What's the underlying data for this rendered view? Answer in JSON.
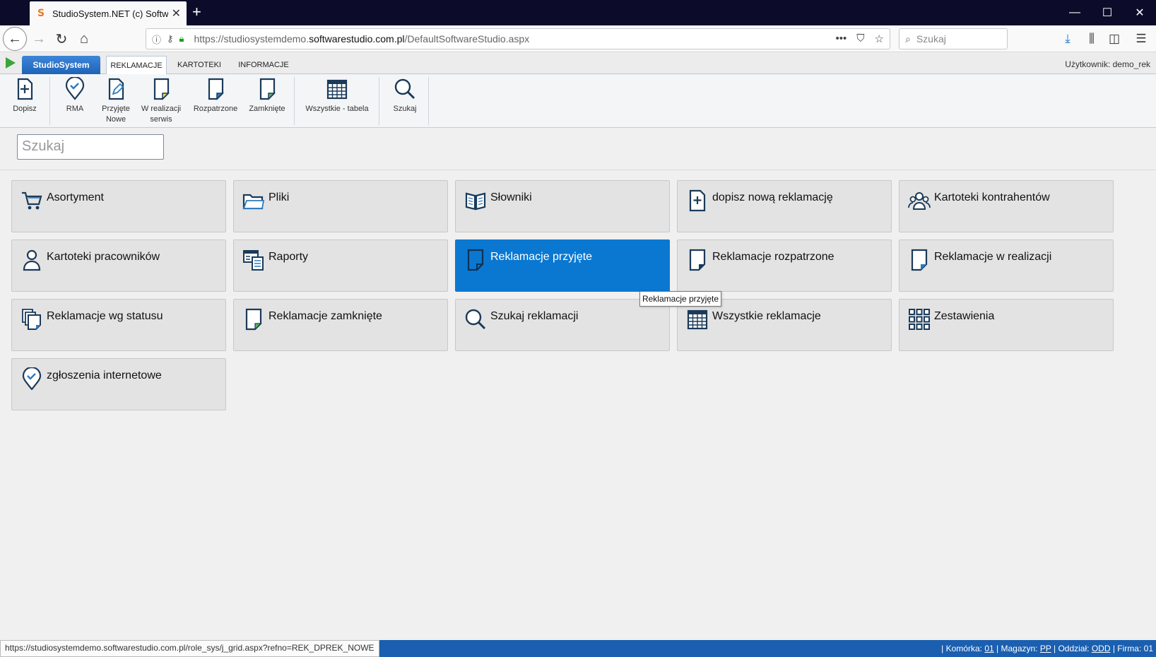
{
  "browser": {
    "tab_title": "StudioSystem.NET (c) Software",
    "url_scheme": "https://studiosystemdemo.",
    "url_host": "softwarestudio.com.pl",
    "url_path": "/DefaultSoftwareStudio.aspx",
    "search_placeholder": "Szukaj"
  },
  "app": {
    "brand_button": "StudioSystem",
    "tabs": [
      {
        "label": "REKLAMACJE",
        "active": true
      },
      {
        "label": "KARTOTEKI",
        "active": false
      },
      {
        "label": "INFORMACJE",
        "active": false
      }
    ],
    "user_label": "Użytkownik: demo_rek"
  },
  "ribbon": {
    "buttons": [
      {
        "label": "Dopisz",
        "icon": "doc-plus-icon"
      },
      {
        "label": "RMA",
        "icon": "map-pin-check-icon"
      },
      {
        "label": "Przyjęte Nowe",
        "icon": "doc-edit-icon"
      },
      {
        "label": "W realizacji serwis",
        "icon": "doc-yellow-corner-icon"
      },
      {
        "label": "Rozpatrzone",
        "icon": "doc-blue-corner-icon"
      },
      {
        "label": "Zamknięte",
        "icon": "doc-green-corner-icon"
      },
      {
        "label": "Wszystkie - tabela",
        "icon": "table-icon"
      },
      {
        "label": "Szukaj",
        "icon": "magnifier-icon"
      }
    ]
  },
  "search": {
    "placeholder": "Szukaj"
  },
  "tiles": [
    {
      "label": "Asortyment",
      "icon": "cart-icon"
    },
    {
      "label": "Pliki",
      "icon": "folder-icon"
    },
    {
      "label": "Słowniki",
      "icon": "book-icon"
    },
    {
      "label": "dopisz nową reklamację",
      "icon": "doc-plus-icon"
    },
    {
      "label": "Kartoteki kontrahentów",
      "icon": "group-icon"
    },
    {
      "label": "Kartoteki pracowników",
      "icon": "person-icon"
    },
    {
      "label": "Raporty",
      "icon": "report-icon"
    },
    {
      "label": "Reklamacje przyjęte",
      "icon": "doc-icon",
      "active": true
    },
    {
      "label": "Reklamacje rozpatrzone",
      "icon": "doc-corner-icon"
    },
    {
      "label": "Reklamacje w realizacji",
      "icon": "doc-corner-icon"
    },
    {
      "label": "Reklamacje wg statusu",
      "icon": "docs-stack-icon"
    },
    {
      "label": "Reklamacje zamknięte",
      "icon": "doc-corner-icon"
    },
    {
      "label": "Szukaj reklamacji",
      "icon": "magnifier-icon"
    },
    {
      "label": "Wszystkie reklamacje",
      "icon": "table-icon"
    },
    {
      "label": "Zestawienia",
      "icon": "grid-icon"
    },
    {
      "label": "zgłoszenia internetowe",
      "icon": "map-pin-check-icon"
    }
  ],
  "tooltip": "Reklamacje przyjęte",
  "status": {
    "link_url": "https://studiosystemdemo.softwarestudio.com.pl/role_sys/j_grid.aspx?refno=REK_DPREK_NOWE",
    "komorka_label": "| Komórka:",
    "komorka_value": "01",
    "magazyn_label": "| Magazyn:",
    "magazyn_value": "PP",
    "oddzial_label": "| Oddział:",
    "oddzial_value": "ODD",
    "firma_label": "| Firma:",
    "firma_value": "01"
  },
  "colors": {
    "accent": "#0a78d1",
    "status_bar": "#1a5fb0",
    "icon": "#1b3a5a"
  }
}
